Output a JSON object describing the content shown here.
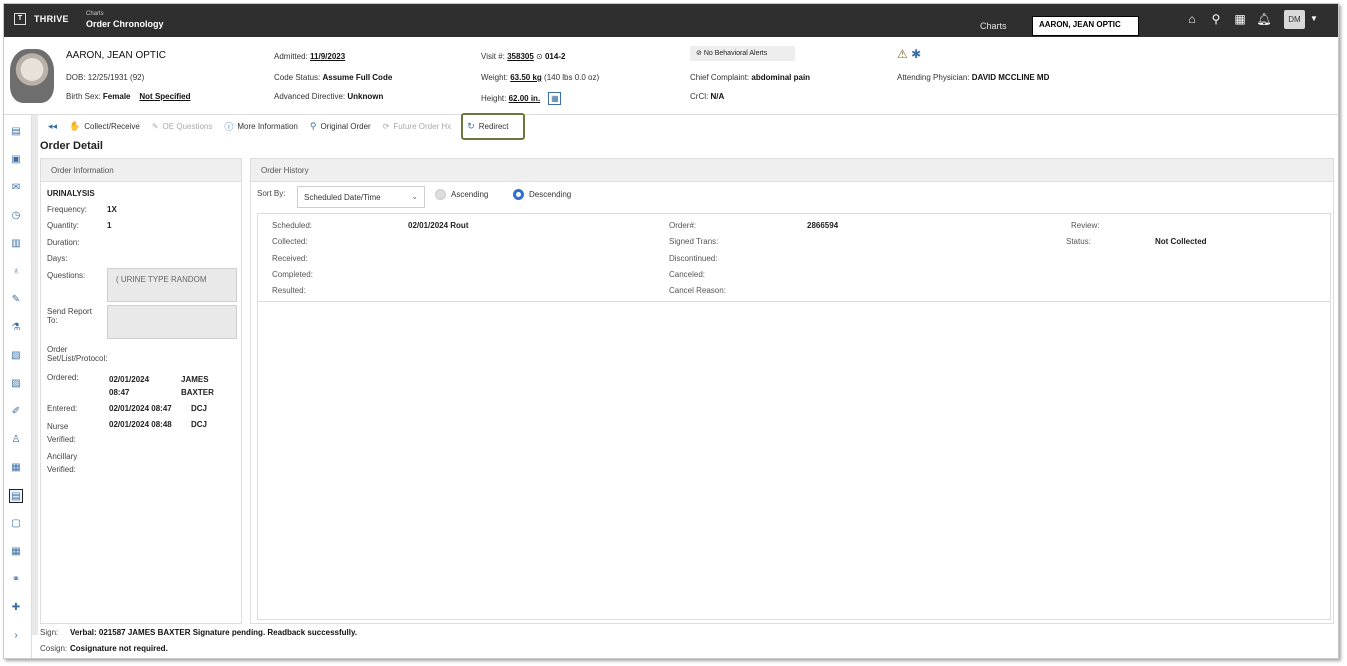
{
  "app": {
    "logo_letter": "T",
    "brand": "THRIVE",
    "breadcrumb_small": "Charts",
    "page_title": "Order Chronology",
    "top_charts_label": "Charts",
    "top_search_value": "AARON, JEAN OPTIC"
  },
  "user": {
    "initials": "DM"
  },
  "patient": {
    "name": "AARON, JEAN OPTIC",
    "dob_label": "DOB:",
    "dob": "12/25/1931 (92)",
    "sex_label": "Birth Sex:",
    "sex": "Female",
    "sex_extra": "Not Specified",
    "admitted_label": "Admitted:",
    "admitted": "11/9/2023",
    "code_status_label": "Code Status:",
    "code_status": "Assume Full Code",
    "adv_dir_label": "Advanced Directive:",
    "adv_dir": "Unknown",
    "visit_label": "Visit #:",
    "visit": "358305",
    "location": "014-2",
    "weight_label": "Weight:",
    "weight": "63.50 kg",
    "weight_alt": "(140 lbs 0.0 oz)",
    "height_label": "Height:",
    "height": "62.00 in.",
    "behavioral": "No Behavioral Alerts",
    "complaint_label": "Chief Complaint:",
    "complaint": "abdominal pain",
    "crcl_label": "CrCl:",
    "crcl": "N/A",
    "attending_label": "Attending Physician:",
    "attending": "DAVID MCCLINE MD"
  },
  "toolbar": {
    "collect": "Collect/Receive",
    "oe_questions": "OE Questions",
    "more_info": "More Information",
    "original_order": "Original Order",
    "future_order": "Future Order Hx",
    "redirect": "Redirect"
  },
  "order_detail": {
    "title": "Order Detail",
    "panel_title": "Order Information",
    "test_name": "URINALYSIS",
    "frequency_label": "Frequency:",
    "frequency": "1X",
    "quantity_label": "Quantity:",
    "quantity": "1",
    "duration_label": "Duration:",
    "days_label": "Days:",
    "questions_label": "Questions:",
    "questions_value": "( URINE TYPE  RANDOM",
    "send_report_label_1": "Send Report",
    "send_report_label_2": "To:",
    "order_set_label_1": "Order",
    "order_set_label_2": "Set/List/Protocol:",
    "ordered_label": "Ordered:",
    "ordered_date": "02/01/2024",
    "ordered_time": "08:47",
    "ordered_by_first": "JAMES",
    "ordered_by_last": "BAXTER",
    "entered_label": "Entered:",
    "entered_value": "02/01/2024 08:47",
    "entered_by": "DCJ",
    "nurse_label_1": "Nurse",
    "nurse_label_2": "Verified:",
    "nurse_value": "02/01/2024 08:48",
    "nurse_by": "DCJ",
    "ancillary_label_1": "Ancillary",
    "ancillary_label_2": "Verified:"
  },
  "history": {
    "panel_title": "Order History",
    "sort_label": "Sort By:",
    "sort_value": "Scheduled Date/Time",
    "ascending": "Ascending",
    "descending": "Descending",
    "record": {
      "scheduled_label": "Scheduled:",
      "scheduled": "02/01/2024 Rout",
      "collected_label": "Collected:",
      "received_label": "Received:",
      "completed_label": "Completed:",
      "resulted_label": "Resulted:",
      "order_num_label": "Order#:",
      "order_num": "2866594",
      "signed_label": "Signed Trans:",
      "discontinued_label": "Discontinued:",
      "canceled_label": "Canceled:",
      "cancel_reason_label": "Cancel Reason:",
      "review_label": "Review:",
      "status_label": "Status:",
      "status": "Not Collected"
    }
  },
  "footer": {
    "sign_label": "Sign:",
    "sign_value": "Verbal: 021587 JAMES BAXTER Signature pending. Readback successfully.",
    "cosign_label": "Cosign:",
    "cosign_value": "Cosignature not required."
  },
  "colors": {
    "topbar": "#2f2f2f",
    "accent": "#2d6fd0",
    "redirect_border": "#6c7740"
  }
}
